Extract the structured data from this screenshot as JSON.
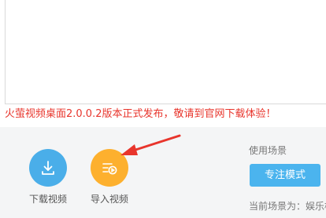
{
  "announcement": {
    "text": "火萤视频桌面2.0.0.2版本正式发布，敬请到官网下载体验！",
    "color": "#e8352c"
  },
  "actions": {
    "download": {
      "label": "下载视频",
      "icon": "download-icon",
      "color": "#4aaee9"
    },
    "import": {
      "label": "导入视频",
      "icon": "import-video-icon",
      "color": "#fdb02e"
    }
  },
  "scene": {
    "title": "使用场景",
    "mode_button_label": "专注模式",
    "current_label": "当前场景为：娱乐模式"
  },
  "colors": {
    "bottom_panel": "#f4f5f6",
    "mode_button": "#4bb4ee",
    "arrow": "#e8352c"
  }
}
